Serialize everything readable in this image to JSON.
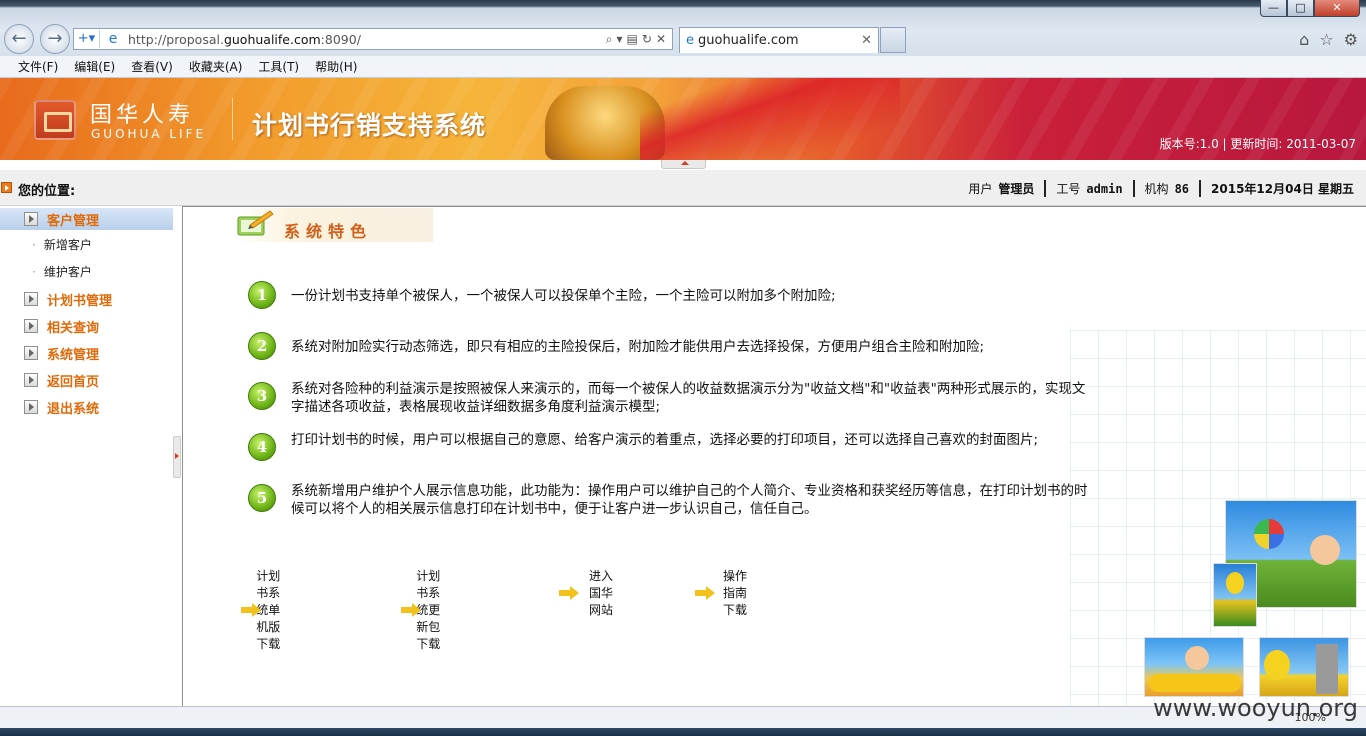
{
  "browser": {
    "url_prefix": "http://proposal.",
    "url_domain": "guohualife.com",
    "url_suffix": ":8090/",
    "tab_title": "guohualife.com",
    "menu": [
      "文件(F)",
      "编辑(E)",
      "查看(V)",
      "收藏夹(A)",
      "工具(T)",
      "帮助(H)"
    ],
    "zoom": "100%"
  },
  "header": {
    "logo_cn": "国华人寿",
    "logo_en": "GUOHUA LIFE",
    "system_title": "计划书行销支持系统",
    "version": "版本号:1.0 | 更新时间: 2011-03-07"
  },
  "location": {
    "label": "您的位置:",
    "user_label": "用户",
    "user_value": "管理员",
    "id_label": "工号",
    "id_value": "admin",
    "org_label": "机构",
    "org_value": "86",
    "date": "2015年12月04日 星期五"
  },
  "sidebar": {
    "items": [
      {
        "label": "客户管理",
        "active": true
      },
      {
        "label": "新增客户"
      },
      {
        "label": "维护客户"
      },
      {
        "label": "计划书管理"
      },
      {
        "label": "相关查询"
      },
      {
        "label": "系统管理"
      },
      {
        "label": "返回首页"
      },
      {
        "label": "退出系统"
      }
    ]
  },
  "main": {
    "heading": "系统特色",
    "features": [
      {
        "num": "1",
        "text": "一份计划书支持单个被保人，一个被保人可以投保单个主险，一个主险可以附加多个附加险;"
      },
      {
        "num": "2",
        "text": "系统对附加险实行动态筛选，即只有相应的主险投保后，附加险才能供用户去选择投保，方便用户组合主险和附加险;"
      },
      {
        "num": "3",
        "text": "系统对各险种的利益演示是按照被保人来演示的，而每一个被保人的收益数据演示分为\"收益文档\"和\"收益表\"两种形式展示的，实现文字描述各项收益，表格展现收益详细数据多角度利益演示模型;"
      },
      {
        "num": "4",
        "text": "打印计划书的时候，用户可以根据自己的意愿、给客户演示的着重点，选择必要的打印项目，还可以选择自己喜欢的封面图片;"
      },
      {
        "num": "5",
        "text": "系统新增用户维护个人展示信息功能，此功能为：操作用户可以维护自己的个人简介、专业资格和获奖经历等信息，在打印计划书的时候可以将个人的相关展示信息打印在计划书中，便于让客户进一步认识自己，信任自己。"
      }
    ],
    "links": [
      "计划书系统单机版下载",
      "计划书系统更新包下载",
      "进入国华网站",
      "操作指南下载"
    ]
  },
  "watermark": "www.wooyun.org"
}
